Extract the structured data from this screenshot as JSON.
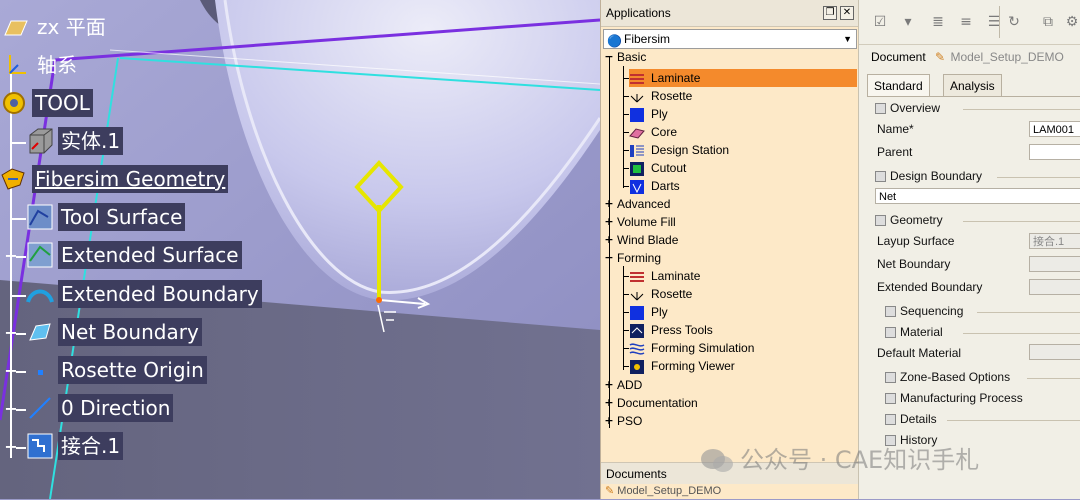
{
  "spec_tree": {
    "items": [
      {
        "label": "zx 平面"
      },
      {
        "label": "轴系"
      },
      {
        "label": "TOOL"
      },
      {
        "label": "实体.1"
      },
      {
        "label": "Fibersim Geometry"
      },
      {
        "label": "Tool Surface"
      },
      {
        "label": "Extended Surface"
      },
      {
        "label": "Extended Boundary"
      },
      {
        "label": "Net Boundary"
      },
      {
        "label": "Rosette Origin"
      },
      {
        "label": "0 Direction"
      },
      {
        "label": "接合.1"
      }
    ]
  },
  "applications": {
    "title": "Applications",
    "selected_workbench": "Fibersim",
    "groups": [
      {
        "label": "Basic",
        "expanded": true,
        "items": [
          {
            "label": "Laminate",
            "icon": "laminate-icon",
            "selected": true
          },
          {
            "label": "Rosette",
            "icon": "rosette-icon"
          },
          {
            "label": "Ply",
            "icon": "ply-icon"
          },
          {
            "label": "Core",
            "icon": "core-icon"
          },
          {
            "label": "Design Station",
            "icon": "design-station-icon"
          },
          {
            "label": "Cutout",
            "icon": "cutout-icon"
          },
          {
            "label": "Darts",
            "icon": "darts-icon"
          }
        ]
      },
      {
        "label": "Advanced",
        "expanded": false
      },
      {
        "label": "Volume Fill",
        "expanded": false
      },
      {
        "label": "Wind Blade",
        "expanded": false
      },
      {
        "label": "Forming",
        "expanded": true,
        "items": [
          {
            "label": "Laminate",
            "icon": "laminate-icon"
          },
          {
            "label": "Rosette",
            "icon": "rosette-icon"
          },
          {
            "label": "Ply",
            "icon": "ply-icon"
          },
          {
            "label": "Press Tools",
            "icon": "press-tools-icon"
          },
          {
            "label": "Forming Simulation",
            "icon": "forming-simulation-icon"
          },
          {
            "label": "Forming Viewer",
            "icon": "forming-viewer-icon"
          }
        ]
      },
      {
        "label": "ADD",
        "expanded": false
      },
      {
        "label": "Documentation",
        "expanded": false
      },
      {
        "label": "PSO",
        "expanded": false
      }
    ],
    "documents_title": "Documents",
    "documents_item": "Model_Setup_DEMO"
  },
  "properties": {
    "document_label": "Document",
    "document_value": "Model_Setup_DEMO",
    "tabs": [
      "Standard",
      "Analysis"
    ],
    "active_tab": "Standard",
    "sections": {
      "overview": "Overview",
      "design_boundary": "Design Boundary",
      "geometry": "Geometry",
      "sequencing": "Sequencing",
      "material": "Material",
      "zone_based": "Zone-Based Options",
      "manufacturing": "Manufacturing Process",
      "details": "Details",
      "history": "History"
    },
    "fields": {
      "name_label": "Name*",
      "name_value": "LAM001",
      "parent_label": "Parent",
      "design_boundary_value": "Net",
      "layup_surface_label": "Layup Surface",
      "layup_surface_value": "接合.1",
      "net_boundary_label": "Net Boundary",
      "extended_boundary_label": "Extended Boundary",
      "default_material_label": "Default Material"
    }
  },
  "watermark": {
    "text": "公众号 · CAE知识手札"
  },
  "colors": {
    "selected_row": "#f48a2c",
    "panel_bg": "#fde9c8",
    "axis_yellow": "#e6e600"
  }
}
